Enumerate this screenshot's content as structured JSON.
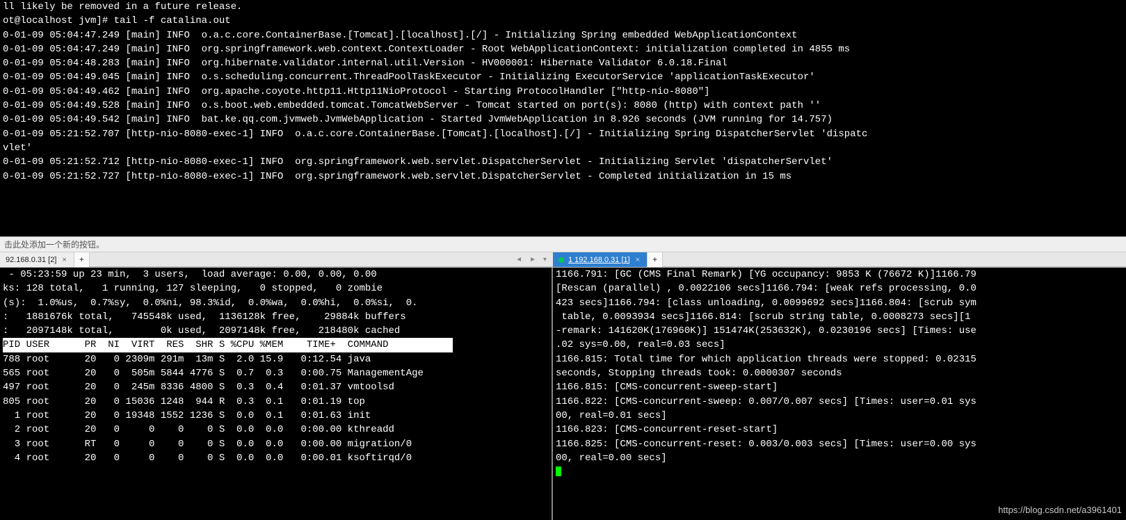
{
  "top": {
    "lines": [
      "ll likely be removed in a future release.",
      "ot@localhost jvm]# tail -f catalina.out",
      "0-01-09 05:04:47.249 [main] INFO  o.a.c.core.ContainerBase.[Tomcat].[localhost].[/] - Initializing Spring embedded WebApplicationContext",
      "0-01-09 05:04:47.249 [main] INFO  org.springframework.web.context.ContextLoader - Root WebApplicationContext: initialization completed in 4855 ms",
      "0-01-09 05:04:48.283 [main] INFO  org.hibernate.validator.internal.util.Version - HV000001: Hibernate Validator 6.0.18.Final",
      "0-01-09 05:04:49.045 [main] INFO  o.s.scheduling.concurrent.ThreadPoolTaskExecutor - Initializing ExecutorService 'applicationTaskExecutor'",
      "0-01-09 05:04:49.462 [main] INFO  org.apache.coyote.http11.Http11NioProtocol - Starting ProtocolHandler [\"http-nio-8080\"]",
      "0-01-09 05:04:49.528 [main] INFO  o.s.boot.web.embedded.tomcat.TomcatWebServer - Tomcat started on port(s): 8080 (http) with context path ''",
      "0-01-09 05:04:49.542 [main] INFO  bat.ke.qq.com.jvmweb.JvmWebApplication - Started JvmWebApplication in 8.926 seconds (JVM running for 14.757)",
      "0-01-09 05:21:52.707 [http-nio-8080-exec-1] INFO  o.a.c.core.ContainerBase.[Tomcat].[localhost].[/] - Initializing Spring DispatcherServlet 'dispatc",
      "vlet'",
      "0-01-09 05:21:52.712 [http-nio-8080-exec-1] INFO  org.springframework.web.servlet.DispatcherServlet - Initializing Servlet 'dispatcherServlet'",
      "0-01-09 05:21:52.727 [http-nio-8080-exec-1] INFO  org.springframework.web.servlet.DispatcherServlet - Completed initialization in 15 ms"
    ]
  },
  "toolbar": {
    "hint": "击此处添加一个新的按钮。"
  },
  "tabs": {
    "left": {
      "label": "92.168.0.31 [2]"
    },
    "right": {
      "label": "1 192.168.0.31 [1]"
    }
  },
  "left": {
    "summary": [
      " - 05:23:59 up 23 min,  3 users,  load average: 0.00, 0.00, 0.00",
      "ks: 128 total,   1 running, 127 sleeping,   0 stopped,   0 zombie",
      "(s):  1.0%us,  0.7%sy,  0.0%ni, 98.3%id,  0.0%wa,  0.0%hi,  0.0%si,  0.",
      ":   1881676k total,   745548k used,  1136128k free,    29884k buffers",
      ":   2097148k total,        0k used,  2097148k free,   218480k cached"
    ],
    "header": "PID USER      PR  NI  VIRT  RES  SHR S %CPU %MEM    TIME+  COMMAND           ",
    "rows": [
      "788 root      20   0 2309m 291m  13m S  2.0 15.9   0:12.54 java",
      "565 root      20   0  505m 5844 4776 S  0.7  0.3   0:00.75 ManagementAge",
      "497 root      20   0  245m 8336 4800 S  0.3  0.4   0:01.37 vmtoolsd",
      "805 root      20   0 15036 1248  944 R  0.3  0.1   0:01.19 top",
      "  1 root      20   0 19348 1552 1236 S  0.0  0.1   0:01.63 init",
      "  2 root      20   0     0    0    0 S  0.0  0.0   0:00.00 kthreadd",
      "  3 root      RT   0     0    0    0 S  0.0  0.0   0:00.00 migration/0",
      "  4 root      20   0     0    0    0 S  0.0  0.0   0:00.01 ksoftirqd/0"
    ]
  },
  "right": {
    "lines": [
      "1166.791: [GC (CMS Final Remark) [YG occupancy: 9853 K (76672 K)]1166.79",
      "[Rescan (parallel) , 0.0022106 secs]1166.794: [weak refs processing, 0.0",
      "423 secs]1166.794: [class unloading, 0.0099692 secs]1166.804: [scrub sym",
      " table, 0.0093934 secs]1166.814: [scrub string table, 0.0008273 secs][1 ",
      "-remark: 141620K(176960K)] 151474K(253632K), 0.0230196 secs] [Times: use",
      ".02 sys=0.00, real=0.03 secs]",
      "1166.815: Total time for which application threads were stopped: 0.02315",
      "seconds, Stopping threads took: 0.0000307 seconds",
      "1166.815: [CMS-concurrent-sweep-start]",
      "1166.822: [CMS-concurrent-sweep: 0.007/0.007 secs] [Times: user=0.01 sys",
      "00, real=0.01 secs]",
      "1166.823: [CMS-concurrent-reset-start]",
      "1166.825: [CMS-concurrent-reset: 0.003/0.003 secs] [Times: user=0.00 sys",
      "00, real=0.00 secs]"
    ]
  },
  "watermark": "https://blog.csdn.net/a3961401"
}
